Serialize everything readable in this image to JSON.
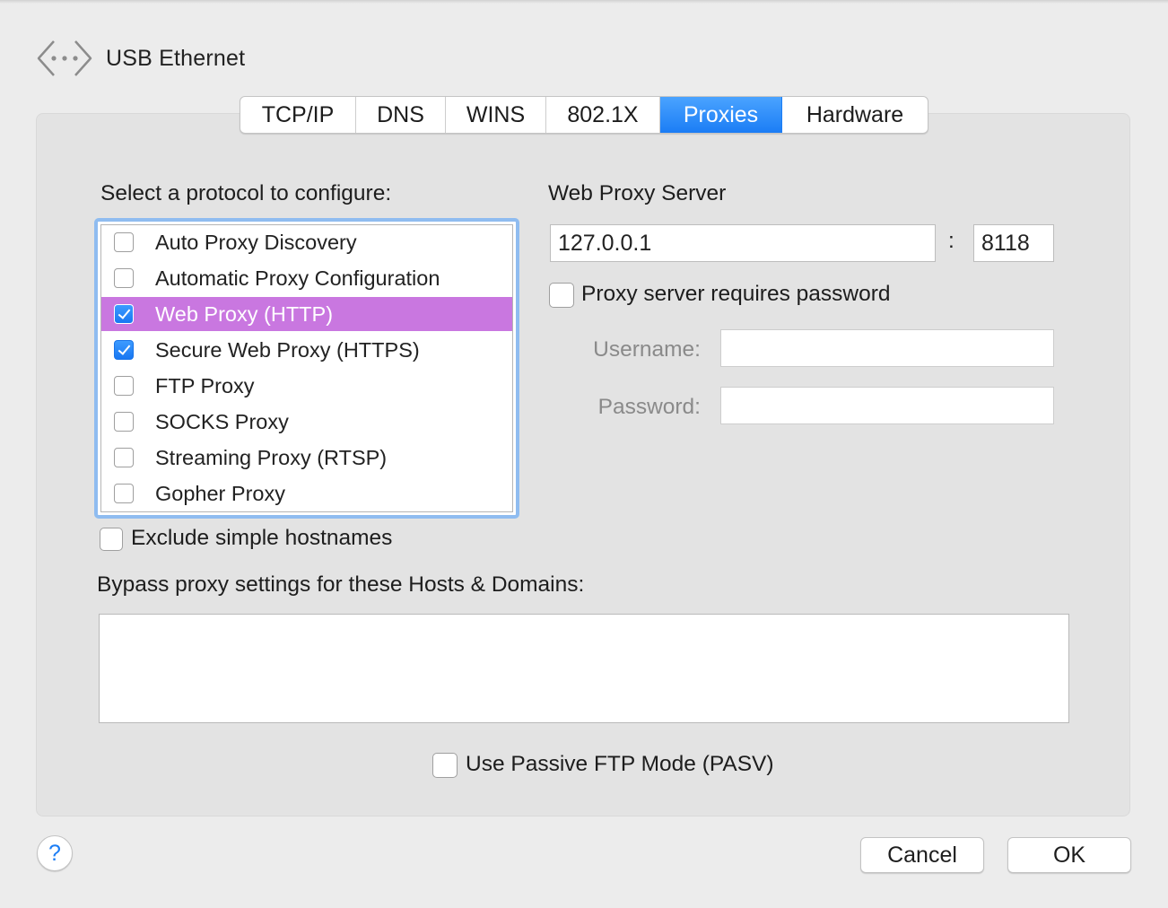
{
  "header": {
    "title": "USB Ethernet",
    "icon": "network-interface-icon"
  },
  "tabs": [
    {
      "label": "TCP/IP"
    },
    {
      "label": "DNS"
    },
    {
      "label": "WINS"
    },
    {
      "label": "802.1X"
    },
    {
      "label": "Proxies",
      "active": true
    },
    {
      "label": "Hardware"
    }
  ],
  "protocols": {
    "heading": "Select a protocol to configure:",
    "items": [
      {
        "label": "Auto Proxy Discovery",
        "checked": false
      },
      {
        "label": "Automatic Proxy Configuration",
        "checked": false
      },
      {
        "label": "Web Proxy (HTTP)",
        "checked": true,
        "selected": true
      },
      {
        "label": "Secure Web Proxy (HTTPS)",
        "checked": true
      },
      {
        "label": "FTP Proxy",
        "checked": false
      },
      {
        "label": "SOCKS Proxy",
        "checked": false
      },
      {
        "label": "Streaming Proxy (RTSP)",
        "checked": false
      },
      {
        "label": "Gopher Proxy",
        "checked": false
      }
    ]
  },
  "exclude_simple_hostnames": {
    "label": "Exclude simple hostnames",
    "checked": false
  },
  "proxy_server": {
    "heading": "Web Proxy Server",
    "host": "127.0.0.1",
    "separator": ":",
    "port": "8118",
    "requires_password_label": "Proxy server requires password",
    "requires_password": false,
    "username_label": "Username:",
    "username": "",
    "password_label": "Password:",
    "password": ""
  },
  "bypass": {
    "label": "Bypass proxy settings for these Hosts & Domains:",
    "value": ""
  },
  "passive_ftp": {
    "label": "Use Passive FTP Mode (PASV)",
    "checked": false
  },
  "footer": {
    "help_label": "?",
    "cancel_label": "Cancel",
    "ok_label": "OK"
  },
  "colors": {
    "accent": "#1b7df5",
    "selection": "#c977e0"
  }
}
